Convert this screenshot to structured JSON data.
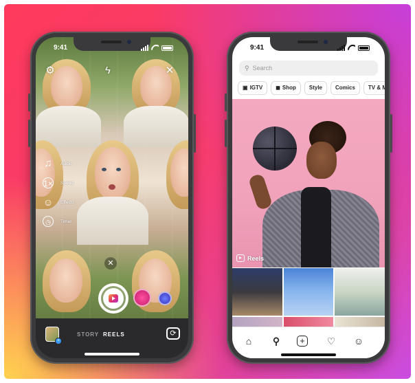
{
  "left_phone": {
    "status": {
      "time": "9:41"
    },
    "top_bar": {
      "settings_icon": "gear-icon",
      "flash_icon": "flash-icon",
      "close_icon": "close-icon"
    },
    "tools": [
      {
        "icon": "music-note-icon",
        "label": "Audio"
      },
      {
        "icon": "speed-icon",
        "label": "Speed"
      },
      {
        "icon": "effects-icon",
        "label": "Effects"
      },
      {
        "icon": "timer-icon",
        "label": "Timer"
      }
    ],
    "modes": {
      "story": "STORY",
      "reels": "REELS"
    },
    "colors": {
      "active_mode": "#ffffff",
      "inactive_mode": "#9b9b9b",
      "bottom_bar": "#2a2a2c"
    }
  },
  "right_phone": {
    "status": {
      "time": "9:41"
    },
    "search": {
      "placeholder": "Search"
    },
    "chips": [
      {
        "icon": "igtv-icon",
        "label": "IGTV"
      },
      {
        "icon": "shop-bag-icon",
        "label": "Shop"
      },
      {
        "icon": "",
        "label": "Style"
      },
      {
        "icon": "",
        "label": "Comics"
      },
      {
        "icon": "",
        "label": "TV & Movie"
      }
    ],
    "hero": {
      "reels_label": "Reels"
    },
    "tabs": [
      {
        "icon": "home-icon"
      },
      {
        "icon": "search-icon"
      },
      {
        "icon": "add-post-icon"
      },
      {
        "icon": "heart-icon"
      },
      {
        "icon": "profile-icon"
      }
    ]
  }
}
